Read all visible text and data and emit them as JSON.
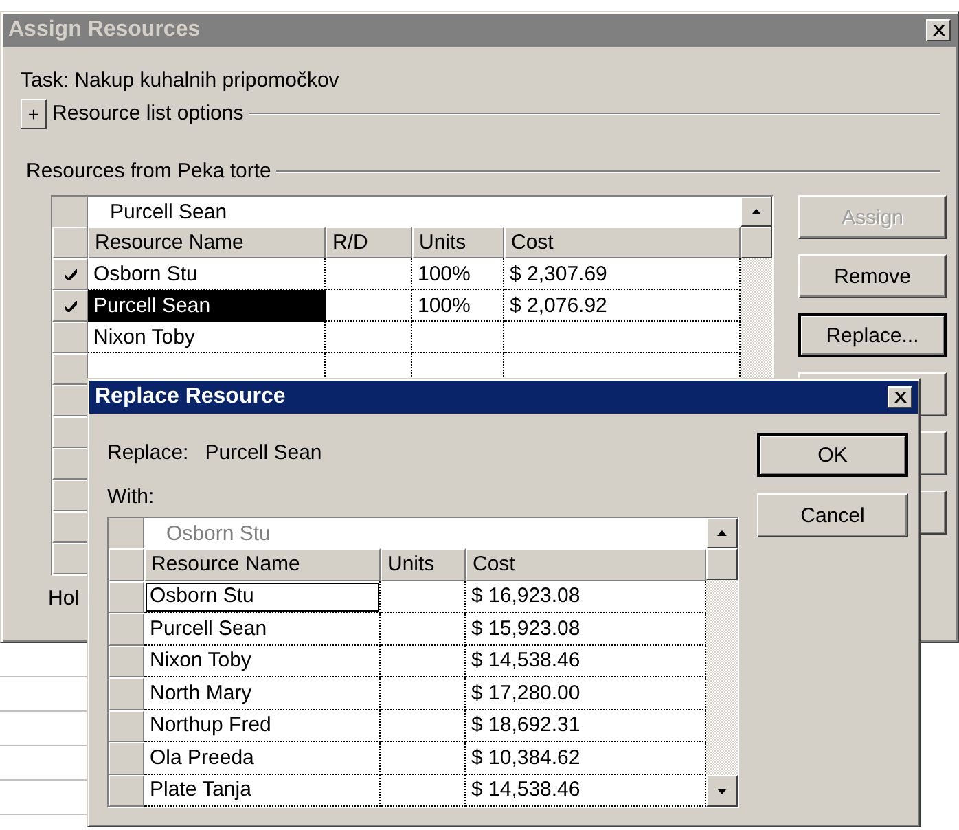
{
  "assign_dialog": {
    "title": "Assign Resources",
    "active": false,
    "task_label": "Task: Nakup kuhalnih pripomočkov",
    "options_toggle": "+",
    "options_label": "Resource list options",
    "resources_label": "Resources from Peka torte",
    "entry_value": "Purcell Sean",
    "columns": [
      "Resource Name",
      "R/D",
      "Units",
      "Cost"
    ],
    "rows": [
      {
        "assigned": true,
        "name": "Osborn Stu",
        "units": "100%",
        "cost": "$ 2,307.69",
        "selected": false
      },
      {
        "assigned": true,
        "name": "Purcell Sean",
        "units": "100%",
        "cost": "$ 2,076.92",
        "selected": true
      },
      {
        "assigned": false,
        "name": "Nixon Toby",
        "selected": false
      },
      {
        "assigned": false,
        "selected": false
      },
      {
        "assigned": false
      },
      {
        "assigned": false
      },
      {
        "assigned": false
      },
      {
        "assigned": false
      },
      {
        "assigned": false
      },
      {
        "assigned": false
      }
    ],
    "footer_text": "Hol",
    "buttons": [
      {
        "label": "Assign",
        "disabled": true,
        "focused": false
      },
      {
        "label": "Remove",
        "disabled": false,
        "focused": false
      },
      {
        "label": "Replace...",
        "disabled": false,
        "focused": true
      },
      {
        "focused": false
      },
      {
        "focused": false
      },
      {
        "focused": false
      }
    ]
  },
  "replace_dialog": {
    "title": "Replace Resource",
    "active": true,
    "replace_label": "Replace:",
    "replace_value": "Purcell Sean",
    "with_label": "With:",
    "entry_value": "Osborn Stu",
    "columns": [
      "Resource Name",
      "Units",
      "Cost"
    ],
    "rows": [
      {
        "name": "Osborn Stu",
        "cost": "$ 16,923.08",
        "selected": true
      },
      {
        "name": "Purcell Sean",
        "cost": "$ 15,923.08",
        "selected": false
      },
      {
        "name": "Nixon Toby",
        "cost": "$ 14,538.46",
        "selected": false
      },
      {
        "name": "North Mary",
        "cost": "$ 17,280.00",
        "selected": false
      },
      {
        "name": "Northup Fred",
        "cost": "$ 18,692.31",
        "selected": false
      },
      {
        "name": "Ola Preeda",
        "cost": "$ 10,384.62",
        "selected": false
      },
      {
        "name": "Plate Tanja",
        "cost": "$ 14,538.46",
        "selected": false
      }
    ],
    "buttons": [
      {
        "label": "OK",
        "focused": true
      },
      {
        "label": "Cancel",
        "focused": false
      }
    ]
  }
}
